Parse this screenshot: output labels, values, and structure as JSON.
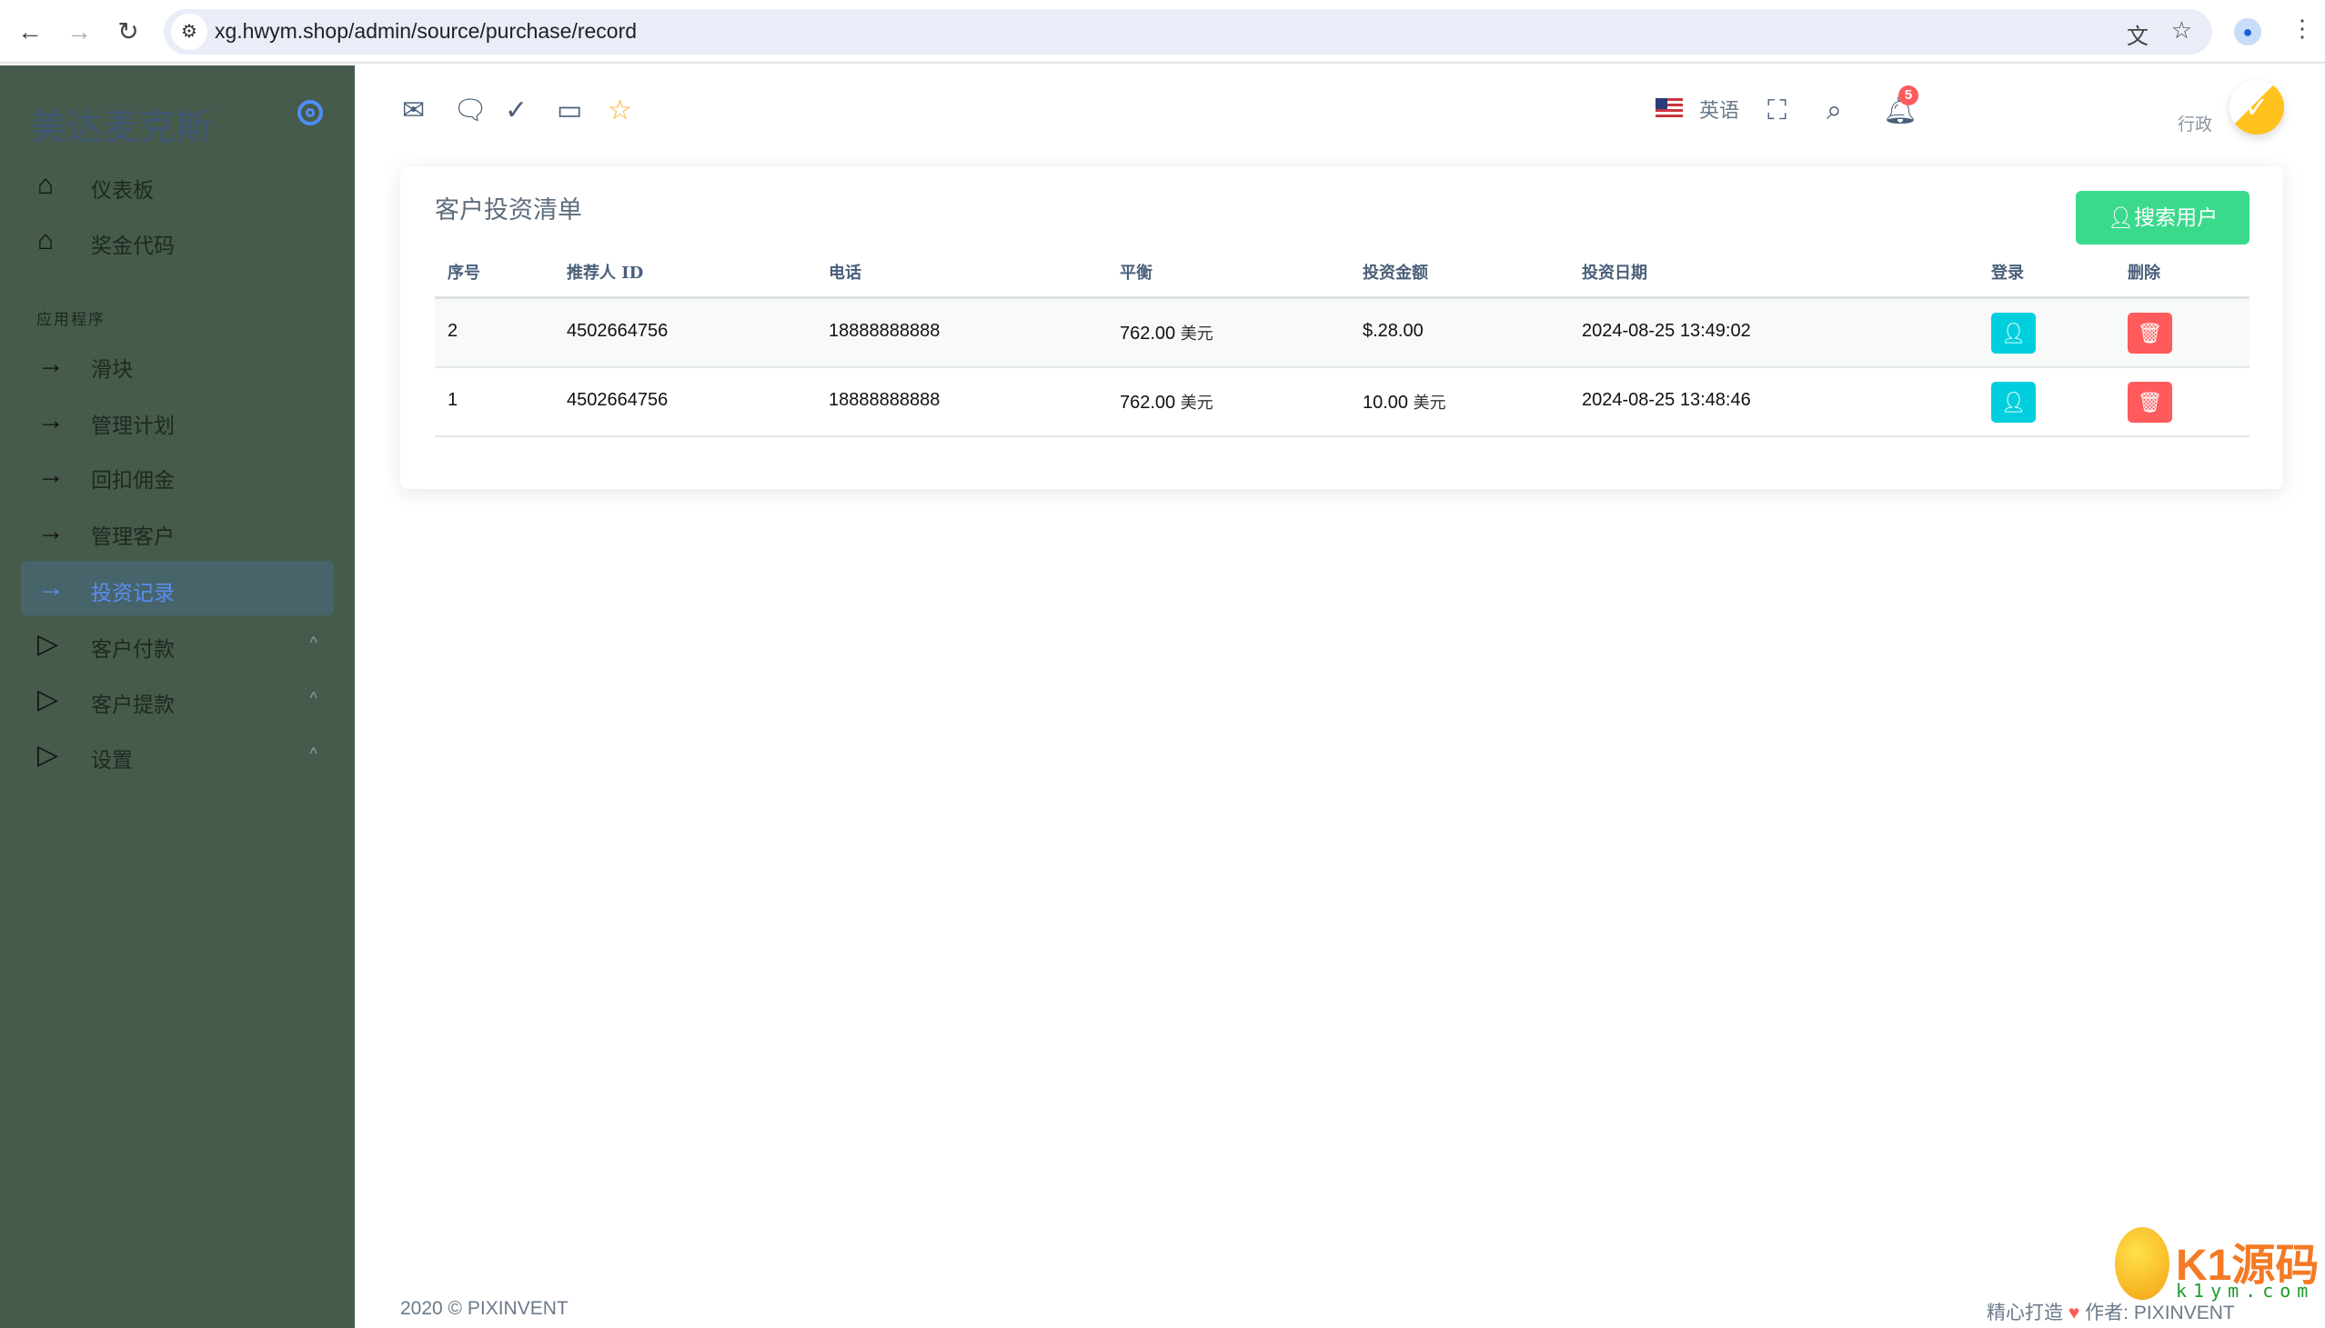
{
  "browser": {
    "url": "xg.hwym.shop/admin/source/purchase/record"
  },
  "sidebar": {
    "brand": "美达麦克斯",
    "items": [
      {
        "label": "仪表板"
      },
      {
        "label": "奖金代码"
      }
    ],
    "section_label": "应用程序",
    "app_items": [
      {
        "label": "滑块"
      },
      {
        "label": "管理计划"
      },
      {
        "label": "回扣佣金"
      },
      {
        "label": "管理客户"
      },
      {
        "label": "投资记录",
        "active": true
      }
    ],
    "group_items": [
      {
        "label": "客户付款"
      },
      {
        "label": "客户提款"
      },
      {
        "label": "设置"
      }
    ]
  },
  "topbar": {
    "language": "英语",
    "notification_count": "5",
    "user_role": "行政"
  },
  "card": {
    "title": "客户投资清单",
    "search_button": "搜索用户",
    "columns": [
      "序号",
      "推荐人 ID",
      "电话",
      "平衡",
      "投资金额",
      "投资日期",
      "登录",
      "删除"
    ],
    "rows": [
      {
        "no": "2",
        "referrer_id": "4502664756",
        "phone": "18888888888",
        "balance": "762.00",
        "balance_unit": "美元",
        "amount": "$.28.00",
        "amount_unit": "",
        "date": "2024-08-25 13:49:02"
      },
      {
        "no": "1",
        "referrer_id": "4502664756",
        "phone": "18888888888",
        "balance": "762.00",
        "balance_unit": "美元",
        "amount": "10.00",
        "amount_unit": "美元",
        "date": "2024-08-25 13:48:46"
      }
    ]
  },
  "footer": {
    "copyright": "2020 © PIXINVENT",
    "crafted": "精心打造",
    "author_label": "作者:",
    "author": "PIXINVENT"
  },
  "watermark": {
    "text": "K1源码",
    "domain": "k1ym.com"
  },
  "colors": {
    "sidebar": "#465b4b",
    "accent": "#5b8def",
    "success": "#3ad98b",
    "info": "#00cfdd",
    "danger": "#ff5b5c"
  }
}
